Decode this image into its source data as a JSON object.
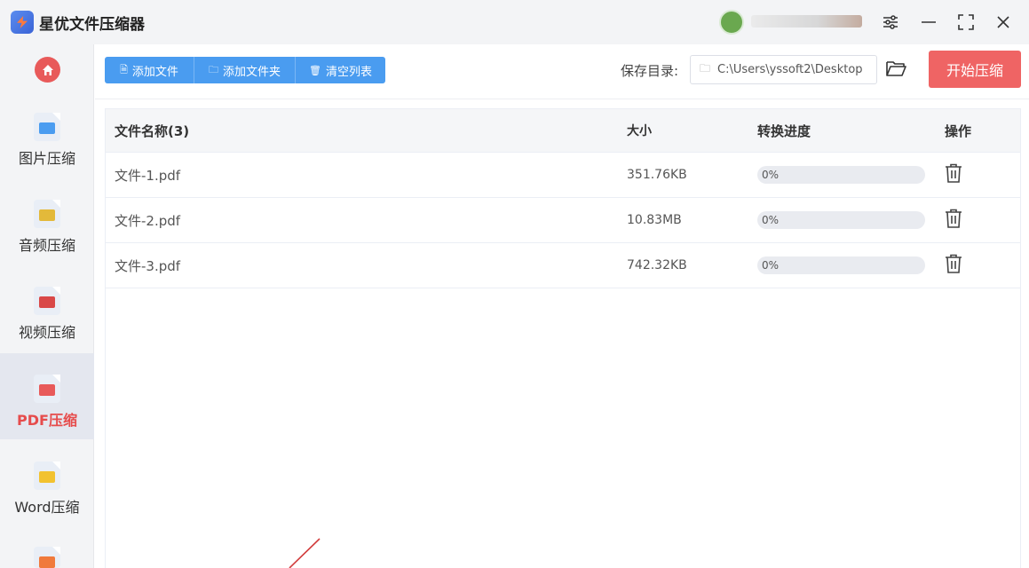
{
  "app": {
    "title": "星优文件压缩器"
  },
  "sidebar": {
    "items": [
      {
        "label": "图片压缩",
        "icon": "image-file-icon",
        "color": "#4a9cf0"
      },
      {
        "label": "音频压缩",
        "icon": "audio-file-icon",
        "color": "#e3b93a"
      },
      {
        "label": "视频压缩",
        "icon": "video-file-icon",
        "color": "#d94848"
      },
      {
        "label": "PDF压缩",
        "icon": "pdf-file-icon",
        "color": "#e85a5a"
      },
      {
        "label": "Word压缩",
        "icon": "word-file-icon",
        "color": "#f2c230"
      }
    ]
  },
  "toolbar": {
    "add_file": "添加文件",
    "add_folder": "添加文件夹",
    "clear_list": "清空列表",
    "save_label": "保存目录:",
    "save_path": "C:\\Users\\yssoft2\\Desktop",
    "start": "开始压缩"
  },
  "table": {
    "headers": {
      "name": "文件名称(3)",
      "size": "大小",
      "progress": "转换进度",
      "action": "操作"
    },
    "rows": [
      {
        "name": "文件-1.pdf",
        "size": "351.76KB",
        "progress": "0%",
        "progress_value": 0
      },
      {
        "name": "文件-2.pdf",
        "size": "10.83MB",
        "progress": "0%",
        "progress_value": 0
      },
      {
        "name": "文件-3.pdf",
        "size": "742.32KB",
        "progress": "0%",
        "progress_value": 0
      }
    ]
  },
  "colors": {
    "accent_blue": "#4a9cf0",
    "accent_red": "#ef6464",
    "active_text": "#e64c4c"
  }
}
